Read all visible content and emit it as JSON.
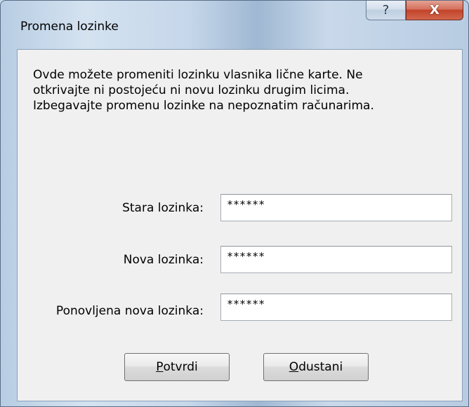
{
  "window": {
    "title": "Promena lozinke",
    "help_glyph": "?",
    "close_glyph": "X"
  },
  "message": {
    "lines": [
      "Ovde možete promeniti lozinku vlasnika lične karte. Ne",
      "otkrivajte ni postojeću ni novu lozinku drugim licima.",
      "Izbegavajte promenu lozinke na nepoznatim računarima."
    ]
  },
  "fields": [
    {
      "label": "Stara lozinka:",
      "value": "******"
    },
    {
      "label": "Nova lozinka:",
      "value": "******"
    },
    {
      "label": "Ponovljena nova lozinka:",
      "value": "******"
    }
  ],
  "buttons": {
    "confirm": {
      "mnemonic": "P",
      "rest": "otvrdi"
    },
    "cancel": {
      "mnemonic": "O",
      "rest": "dustani"
    }
  }
}
